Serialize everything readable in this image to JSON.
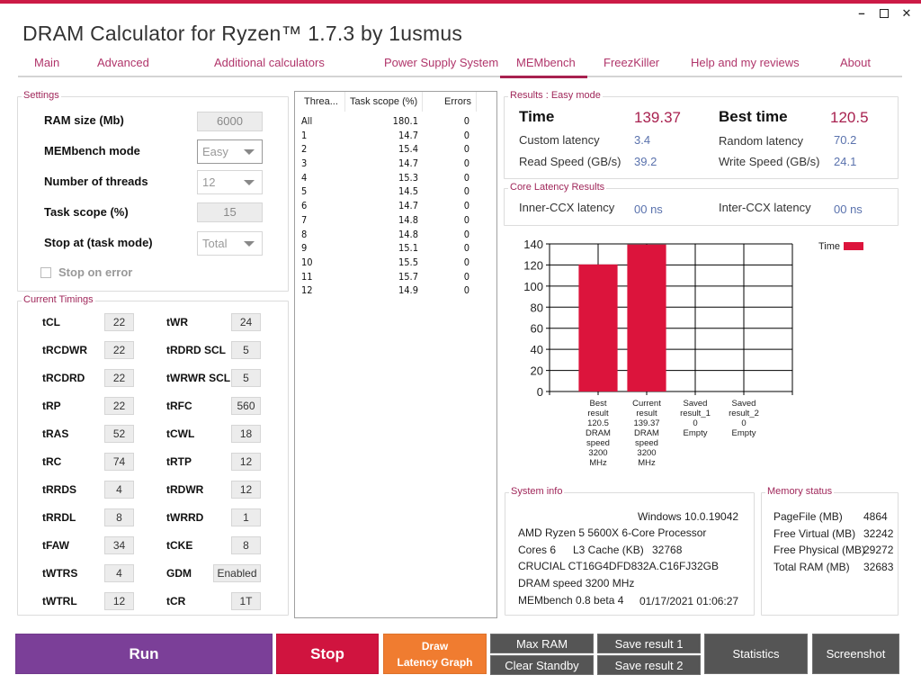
{
  "window": {
    "title": "DRAM Calculator for Ryzen™ 1.7.3 by 1usmus",
    "controls": {
      "minimize": "–",
      "maximize": "",
      "close": "✕"
    },
    "accent": "#cc1a46"
  },
  "tabs": [
    {
      "label": "Main",
      "active": false
    },
    {
      "label": "Advanced",
      "active": false
    },
    {
      "label": "Additional calculators",
      "active": false
    },
    {
      "label": "Power Supply System",
      "active": false
    },
    {
      "label": "MEMbench",
      "active": true
    },
    {
      "label": "FreezKiller",
      "active": false
    },
    {
      "label": "Help and my reviews",
      "active": false
    },
    {
      "label": "About",
      "active": false
    }
  ],
  "settings": {
    "legend": "Settings",
    "ram_size_label": "RAM size (Mb)",
    "ram_size_value": "6000",
    "mode_label": "MEMbench mode",
    "mode_value": "Easy",
    "threads_label": "Number of threads",
    "threads_value": "12",
    "task_scope_label": "Task scope (%)",
    "task_scope_value": "15",
    "stop_at_label": "Stop at (task mode)",
    "stop_at_value": "Total",
    "stop_on_error_label": "Stop on error",
    "stop_on_error_checked": false
  },
  "timings": {
    "legend": "Current Timings",
    "left": [
      {
        "name": "tCL",
        "value": "22"
      },
      {
        "name": "tRCDWR",
        "value": "22"
      },
      {
        "name": "tRCDRD",
        "value": "22"
      },
      {
        "name": "tRP",
        "value": "22"
      },
      {
        "name": "tRAS",
        "value": "52"
      },
      {
        "name": "tRC",
        "value": "74"
      },
      {
        "name": "tRRDS",
        "value": "4"
      },
      {
        "name": "tRRDL",
        "value": "8"
      },
      {
        "name": "tFAW",
        "value": "34"
      },
      {
        "name": "tWTRS",
        "value": "4"
      },
      {
        "name": "tWTRL",
        "value": "12"
      }
    ],
    "right": [
      {
        "name": "tWR",
        "value": "24"
      },
      {
        "name": "tRDRD SCL",
        "value": "5"
      },
      {
        "name": "tWRWR SCL",
        "value": "5"
      },
      {
        "name": "tRFC",
        "value": "560"
      },
      {
        "name": "tCWL",
        "value": "18"
      },
      {
        "name": "tRTP",
        "value": "12"
      },
      {
        "name": "tRDWR",
        "value": "12"
      },
      {
        "name": "tWRRD",
        "value": "1"
      },
      {
        "name": "tCKE",
        "value": "8"
      },
      {
        "name": "GDM",
        "value": "Enabled"
      },
      {
        "name": "tCR",
        "value": "1T"
      }
    ]
  },
  "thread_table": {
    "columns": [
      "Threa...",
      "Task scope (%)",
      "Errors"
    ],
    "rows": [
      [
        "All",
        "180.1",
        "0"
      ],
      [
        "1",
        "14.7",
        "0"
      ],
      [
        "2",
        "15.4",
        "0"
      ],
      [
        "3",
        "14.7",
        "0"
      ],
      [
        "4",
        "15.3",
        "0"
      ],
      [
        "5",
        "14.5",
        "0"
      ],
      [
        "6",
        "14.7",
        "0"
      ],
      [
        "7",
        "14.8",
        "0"
      ],
      [
        "8",
        "14.8",
        "0"
      ],
      [
        "9",
        "15.1",
        "0"
      ],
      [
        "10",
        "15.5",
        "0"
      ],
      [
        "11",
        "15.7",
        "0"
      ],
      [
        "12",
        "14.9",
        "0"
      ]
    ]
  },
  "results": {
    "legend": "Results : Easy mode",
    "time_label": "Time",
    "time_value": "139.37",
    "best_time_label": "Best time",
    "best_time_value": "120.5",
    "custom_latency_label": "Custom latency",
    "custom_latency_value": "3.4",
    "random_latency_label": "Random latency",
    "random_latency_value": "70.2",
    "read_speed_label": "Read Speed (GB/s)",
    "read_speed_value": "39.2",
    "write_speed_label": "Write Speed (GB/s)",
    "write_speed_value": "24.1"
  },
  "core_latency": {
    "legend": "Core Latency Results",
    "inner_label": "Inner-CCX latency",
    "inner_value": "00 ns",
    "inter_label": "Inter-CCX latency",
    "inter_value": "00 ns"
  },
  "chart_data": {
    "type": "bar",
    "title": "",
    "xlabel": "",
    "ylabel": "",
    "categories": [
      [
        "Best",
        "result",
        "120.5",
        "DRAM",
        "speed",
        "3200",
        "MHz"
      ],
      [
        "Current",
        "result",
        "139.37",
        "DRAM",
        "speed",
        "3200",
        "MHz"
      ],
      [
        "Saved",
        "result_1",
        "0",
        "Empty"
      ],
      [
        "Saved",
        "result_2",
        "0",
        "Empty"
      ]
    ],
    "series": [
      {
        "name": "Time",
        "color": "#dc143c",
        "values": [
          120.5,
          139.37,
          0,
          0
        ]
      }
    ],
    "ylim": [
      0,
      140
    ],
    "yticks": [
      0,
      20,
      40,
      60,
      80,
      100,
      120,
      140
    ],
    "grid": true,
    "legend_position": "top-right"
  },
  "system_info": {
    "legend": "System info",
    "os": "Windows 10.0.19042",
    "cpu": "AMD Ryzen 5 5600X 6-Core Processor",
    "cores": "Cores 6",
    "l3_label": "L3 Cache (KB)",
    "l3_value": "32768",
    "memory_module": "CRUCIAL CT16G4DFD832A.C16FJ32GB",
    "dram_speed": "DRAM speed 3200 MHz",
    "membench_version": "MEMbench 0.8 beta 4",
    "timestamp": "01/17/2021 01:06:27"
  },
  "memory_status": {
    "legend": "Memory status",
    "items": [
      {
        "label": "PageFile (MB)",
        "value": "4864"
      },
      {
        "label": "Free Virtual (MB)",
        "value": "32242"
      },
      {
        "label": "Free Physical (MB)",
        "value": "29272"
      },
      {
        "label": "Total RAM (MB)",
        "value": "32683"
      }
    ]
  },
  "buttons": {
    "run": "Run",
    "stop": "Stop",
    "draw_line1": "Draw",
    "draw_line2": "Latency Graph",
    "max_ram": "Max RAM",
    "clear_standby": "Clear Standby",
    "save_result_1": "Save result 1",
    "save_result_2": "Save result 2",
    "statistics": "Statistics",
    "screenshot": "Screenshot",
    "colors": {
      "run": "#7b3f98",
      "stop": "#d0143f",
      "draw": "#f07c30",
      "gray": "#555555"
    }
  }
}
